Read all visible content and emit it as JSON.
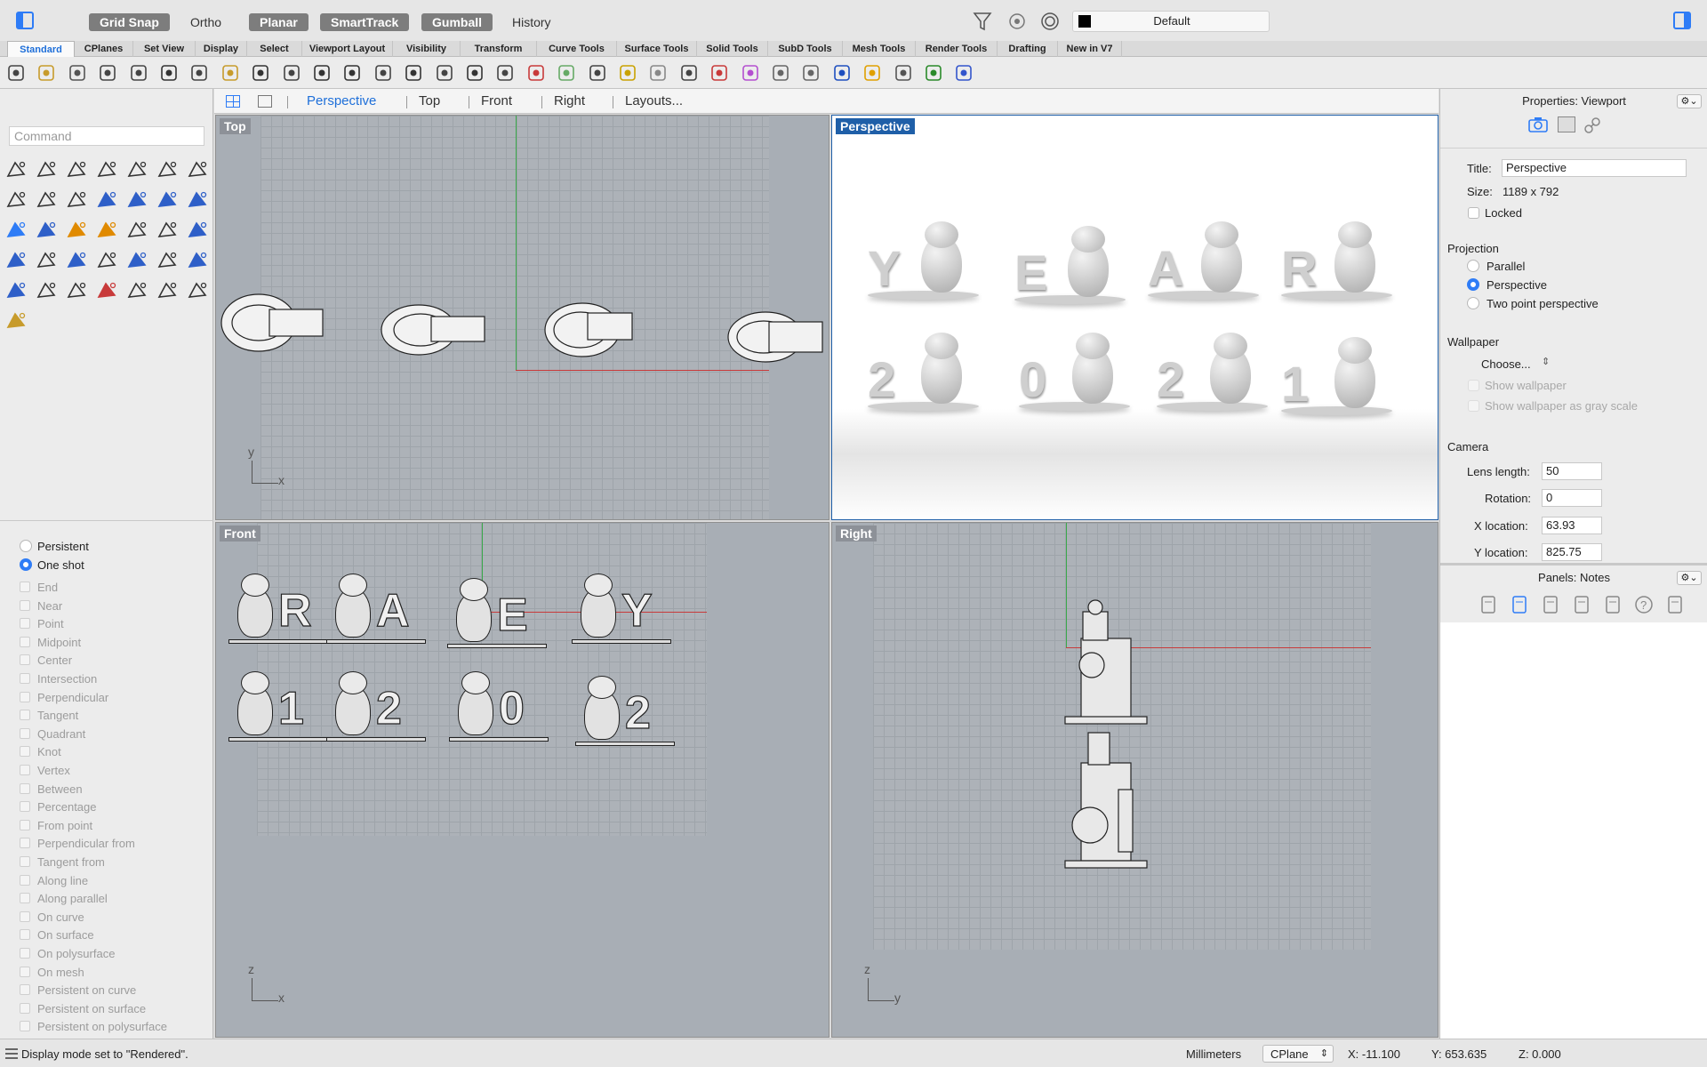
{
  "topbar": {
    "buttons": [
      {
        "label": "Grid Snap",
        "on": true
      },
      {
        "label": "Ortho",
        "on": false
      },
      {
        "label": "Planar",
        "on": true
      },
      {
        "label": "SmartTrack",
        "on": true
      },
      {
        "label": "Gumball",
        "on": true
      },
      {
        "label": "History",
        "on": false
      }
    ],
    "layer": "Default"
  },
  "tabs": [
    "Standard",
    "CPlanes",
    "Set View",
    "Display",
    "Select",
    "Viewport Layout",
    "Visibility",
    "Transform",
    "Curve Tools",
    "Surface Tools",
    "Solid Tools",
    "SubD Tools",
    "Mesh Tools",
    "Render Tools",
    "Drafting",
    "New in V7"
  ],
  "toolbar_icons": [
    "new-file-icon",
    "open-file-icon",
    "save-icon",
    "print-icon",
    "export-icon",
    "cut-icon",
    "copy-icon",
    "paste-icon",
    "undo-icon",
    "pan-hand-icon",
    "rotate-view-icon",
    "zoom-icon",
    "zoom-window-icon",
    "zoom-extents-icon",
    "zoom-selected-icon",
    "undo-view-icon",
    "four-viewports-icon",
    "car-object-icon",
    "grid-toggle-icon",
    "cplane-icon",
    "snap-icon",
    "light-icon",
    "lock-icon",
    "materials-icon",
    "color-wheel-icon",
    "shaded-sphere-icon",
    "render-mesh-icon",
    "render-sphere-icon",
    "color-pick-icon",
    "transform-icon",
    "globe-icon",
    "help-icon"
  ],
  "command": {
    "placeholder": "Command"
  },
  "viewtabs": {
    "items": [
      "Perspective",
      "Top",
      "Front",
      "Right",
      "Layouts..."
    ],
    "active": "Perspective"
  },
  "viewports": {
    "top": {
      "label": "Top",
      "axis_v": "y",
      "axis_h": "x"
    },
    "perspective": {
      "label": "Perspective"
    },
    "front": {
      "label": "Front",
      "axis_v": "z",
      "axis_h": "x"
    },
    "right": {
      "label": "Right",
      "axis_v": "z",
      "axis_h": "y"
    }
  },
  "perspective_letters": [
    "Y",
    "E",
    "A",
    "R",
    "2",
    "0",
    "2",
    "1"
  ],
  "front_letters": [
    "R",
    "A",
    "E",
    "Y",
    "1",
    "2",
    "0",
    "2"
  ],
  "osnap": {
    "modes": [
      {
        "label": "Persistent",
        "selected": false
      },
      {
        "label": "One shot",
        "selected": true
      }
    ],
    "items": [
      "End",
      "Near",
      "Point",
      "Midpoint",
      "Center",
      "Intersection",
      "Perpendicular",
      "Tangent",
      "Quadrant",
      "Knot",
      "Vertex",
      "Between",
      "Percentage",
      "From point",
      "Perpendicular from",
      "Tangent from",
      "Along line",
      "Along parallel",
      "On curve",
      "On surface",
      "On polysurface",
      "On mesh",
      "Persistent on curve",
      "Persistent on surface",
      "Persistent on polysurface"
    ]
  },
  "properties": {
    "header": "Properties: Viewport",
    "title_label": "Title:",
    "title_value": "Perspective",
    "size_label": "Size:",
    "size_value": "1189 x 792",
    "locked_label": "Locked",
    "projection_header": "Projection",
    "projection_options": [
      {
        "label": "Parallel",
        "selected": false
      },
      {
        "label": "Perspective",
        "selected": true
      },
      {
        "label": "Two point perspective",
        "selected": false
      }
    ],
    "wallpaper_header": "Wallpaper",
    "wallpaper_choose": "Choose...",
    "show_wallpaper": "Show wallpaper",
    "show_wallpaper_gray": "Show wallpaper as gray scale",
    "camera_header": "Camera",
    "lens_label": "Lens length:",
    "lens_value": "50",
    "rotation_label": "Rotation:",
    "rotation_value": "0",
    "xloc_label": "X location:",
    "xloc_value": "63.93",
    "yloc_label": "Y location:",
    "yloc_value": "825.75"
  },
  "panels": {
    "header": "Panels: Notes"
  },
  "status": {
    "message": "Display mode set to \"Rendered\".",
    "units": "Millimeters",
    "cplane": "CPlane",
    "x": "X: -11.100",
    "y": "Y: 653.635",
    "z": "Z: 0.000"
  },
  "colors": {
    "accent": "#1e6fd9",
    "active_viewport": "#1f5fa8",
    "x_axis": "#c83a3a",
    "y_axis": "#3aa84a"
  }
}
